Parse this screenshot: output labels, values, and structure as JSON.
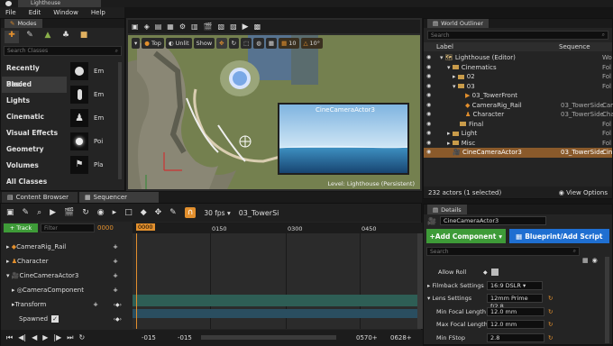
{
  "window": {
    "tab_title": "Lighthouse"
  },
  "menu": [
    "File",
    "Edit",
    "Window",
    "Help"
  ],
  "modes": {
    "title": "Modes",
    "search_placeholder": "Search Classes",
    "categories": [
      "Recently Placed",
      "Basic",
      "Lights",
      "Cinematic",
      "Visual Effects",
      "Geometry",
      "Volumes",
      "All Classes"
    ],
    "selected_category": "Basic",
    "items": [
      "Em",
      "Em",
      "Em",
      "Poi",
      "Pla"
    ]
  },
  "viewport": {
    "view_mode": "Top",
    "lighting_mode": "Unlit",
    "show_label": "Show",
    "grid_value": "10",
    "rotation_value": "10°",
    "preview_title": "CineCameraActor3",
    "level_label": "Level:  Lighthouse (Persistent)"
  },
  "outliner": {
    "title": "World Outliner",
    "search_placeholder": "Search",
    "col_label": "Label",
    "col_sequence": "Sequence",
    "rows": [
      {
        "label": "Lighthouse (Editor)",
        "type": "Wo",
        "seq": ""
      },
      {
        "label": "Cinematics",
        "type": "Fol",
        "seq": ""
      },
      {
        "label": "02",
        "type": "Fol",
        "seq": ""
      },
      {
        "label": "03",
        "type": "Fol",
        "seq": ""
      },
      {
        "label": "03_TowerFront",
        "type": "",
        "seq": ""
      },
      {
        "label": "CameraRig_Rail",
        "type": "Cam",
        "seq": "03_TowerSide"
      },
      {
        "label": "Character",
        "type": "Cha",
        "seq": "03_TowerSide"
      },
      {
        "label": "Final",
        "type": "Fol",
        "seq": ""
      },
      {
        "label": "Light",
        "type": "Fol",
        "seq": ""
      },
      {
        "label": "Misc",
        "type": "Fol",
        "seq": ""
      },
      {
        "label": "CineCameraActor3",
        "type": "Cin",
        "seq": "03_TowerSide"
      }
    ],
    "footer_count": "232 actors (1 selected)",
    "view_options": "View Options"
  },
  "bottom_tabs": {
    "content_browser": "Content Browser",
    "sequencer": "Sequencer"
  },
  "sequencer": {
    "fps": "30 fps",
    "sequence_name": "03_TowerSi",
    "track_button": "+ Track",
    "filter_placeholder": "Filter",
    "frame_field": "0000",
    "playhead": "0000",
    "ruler": [
      "0150",
      "0300",
      "0450"
    ],
    "tracks": [
      "CameraRig_Rail",
      "Character",
      "CineCameraActor3",
      "CameraComponent",
      "Transform",
      "Spawned"
    ],
    "range_start": "-015",
    "range_start2": "-015",
    "range_end": "0570+",
    "range_end2": "0628+"
  },
  "details": {
    "title": "Details",
    "actor_name": "CineCameraActor3",
    "add_component": "+Add Component",
    "blueprint_script": "Blueprint/Add Script",
    "search_placeholder": "Search",
    "allow_roll": "Allow Roll",
    "filmback_label": "Filmback Settings",
    "filmback_value": "16:9 DSLR",
    "lens_label": "Lens Settings",
    "lens_value": "12mm Prime f/2.8",
    "min_focal_label": "Min Focal Length",
    "min_focal_value": "12.0 mm",
    "max_focal_label": "Max Focal Length",
    "max_focal_value": "12.0 mm",
    "min_fstop_label": "Min FStop",
    "min_fstop_value": "2.8"
  },
  "colors": {
    "accent": "#e28f2d",
    "green": "#3e9b38",
    "blue": "#1f6fd1",
    "selection": "#8a5a2b"
  }
}
